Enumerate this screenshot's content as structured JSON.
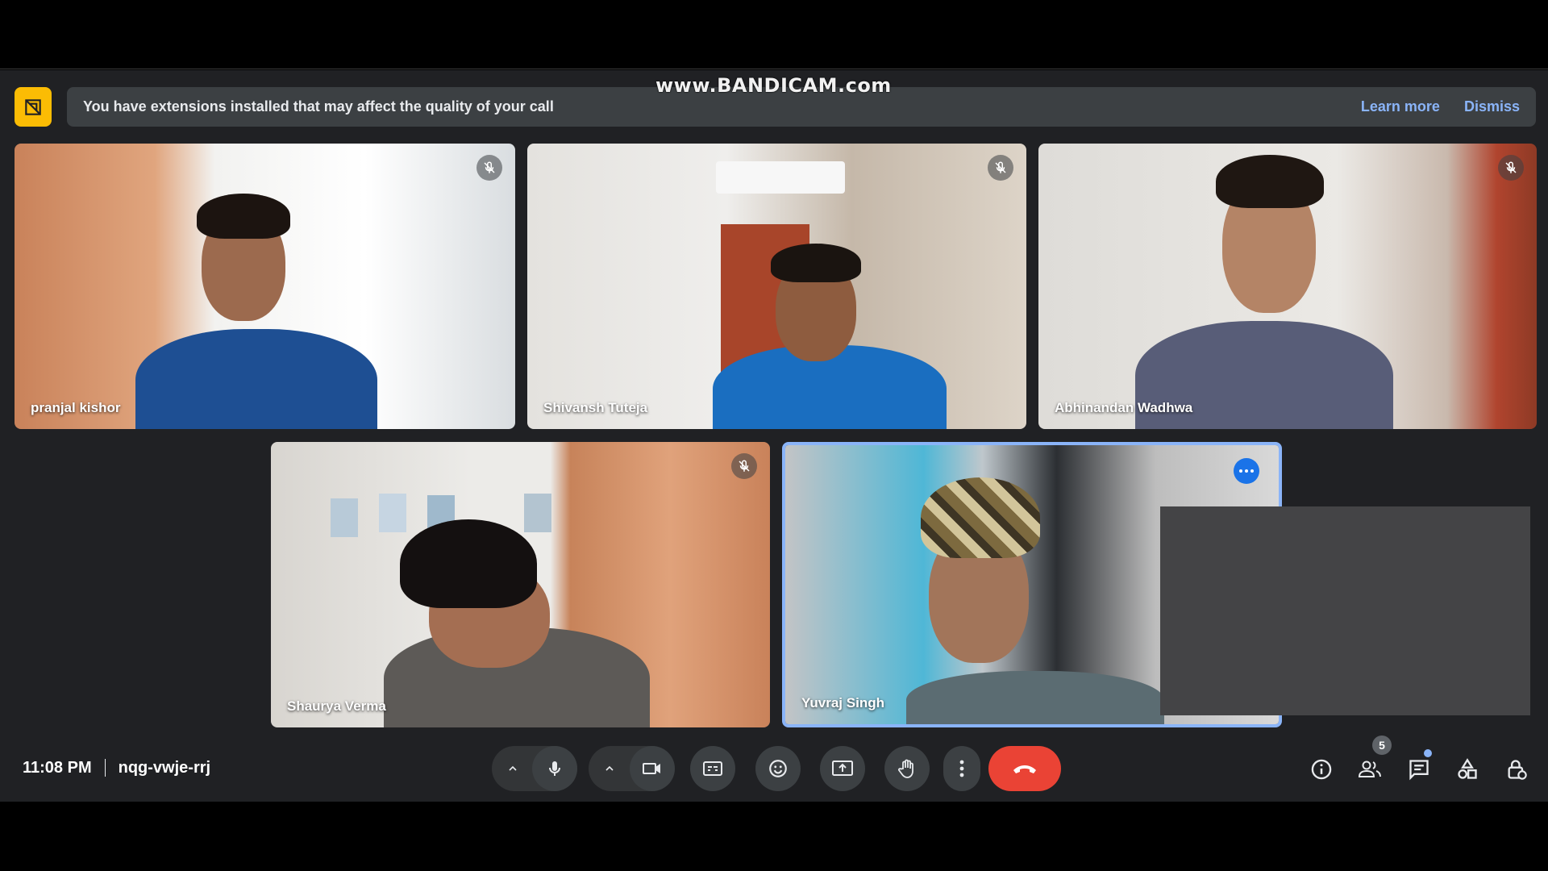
{
  "recorder": {
    "watermark": "www.BANDICAM.com"
  },
  "banner": {
    "message": "You have extensions installed that may affect the quality of your call",
    "learn_more": "Learn more",
    "dismiss": "Dismiss",
    "icon": "extension-warning-icon"
  },
  "participants": [
    {
      "name": "pranjal kishor",
      "muted": true
    },
    {
      "name": "Shivansh Tuteja",
      "muted": true
    },
    {
      "name": "Abhinandan Wadhwa",
      "muted": true
    },
    {
      "name": "Shaurya Verma",
      "muted": true
    },
    {
      "name": "Yuvraj Singh",
      "muted": false,
      "active_speaker": true
    }
  ],
  "footer": {
    "time": "11:08 PM",
    "meeting_code": "nqg-vwje-rrj"
  },
  "controls": {
    "items": [
      "audio-options-caret",
      "microphone",
      "video-options-caret",
      "camera",
      "captions",
      "emoji-reactions",
      "present-screen",
      "raise-hand",
      "more-options",
      "leave-call"
    ],
    "hangup_color": "#ea4335"
  },
  "side_panel": {
    "people_count": "5",
    "items": [
      "meeting-details",
      "people",
      "chat",
      "activities",
      "host-controls"
    ]
  },
  "colors": {
    "accent": "#8ab4f8",
    "surface": "#202124",
    "warning": "#fbbc04"
  }
}
